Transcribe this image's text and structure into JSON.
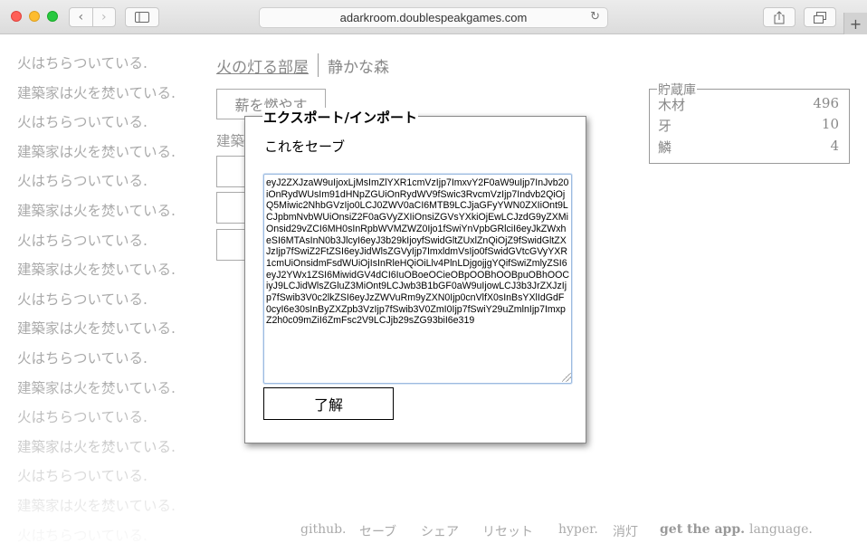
{
  "browser": {
    "url": "adarkroom.doublespeakgames.com",
    "back_glyph": "‹",
    "forward_glyph": "›",
    "reload_glyph": "↻",
    "new_tab_glyph": "+"
  },
  "notifications": [
    "火はちらついている.",
    "建築家は火を焚いている.",
    "火はちらついている.",
    "建築家は火を焚いている.",
    "火はちらついている.",
    "建築家は火を焚いている.",
    "火はちらついている.",
    "建築家は火を焚いている.",
    "火はちらついている.",
    "建築家は火を焚いている.",
    "火はちらついている.",
    "建築家は火を焚いている.",
    "火はちらついている.",
    "建築家は火を焚いている.",
    "火はちらついている.",
    "建築家は火を焚いている.",
    "火はちらついている."
  ],
  "header": {
    "tab_room": "火の灯る部屋",
    "tab_forest": "静かな森"
  },
  "room": {
    "stoke_fire_label": "薪を燃やす",
    "build_label": "建築"
  },
  "stores": {
    "legend": "貯蔵庫",
    "items": [
      {
        "name": "木材",
        "count": "496"
      },
      {
        "name": "牙",
        "count": "10"
      },
      {
        "name": "鱗",
        "count": "4"
      }
    ]
  },
  "dialog": {
    "title": "エクスポート/インポート",
    "description": "これをセーブ",
    "save_string": "eyJ2ZXJzaW9uIjoxLjMsImZlYXR1cmVzIjp7ImxvY2F0aW9uIjp7InJvb20iOnRydWUsIm91dHNpZGUiOnRydWV9fSwic3RvcmVzIjp7Indvb2QiOjQ5Miwic2NhbGVzIjo0LCJ0ZWV0aCI6MTB9LCJjaGFyYWN0ZXIiOnt9LCJpbmNvbWUiOnsiZ2F0aGVyZXIiOnsiZGVsYXkiOjEwLCJzdG9yZXMiOnsid29vZCI6MH0sInRpbWVMZWZ0Ijo1fSwiYnVpbGRlciI6eyJkZWxheSI6MTAsInN0b3JlcyI6eyJ3b29kIjoyfSwidGltZUxlZnQiOjZ9fSwidGltZXJzIjp7fSwiZ2FtZSI6eyJidWlsZGVyIjp7ImxldmVsIjo0fSwidGVtcGVyYXR1cmUiOnsidmFsdWUiOjIsInRleHQiOiLlv4PlnLDjgojjgYQifSwiZmlyZSI6eyJ2YWx1ZSI6MiwidGV4dCI6IuOBoeOCieOBpOOBhOOBpuOBhOOCiyJ9LCJidWlsZGluZ3MiOnt9LCJwb3B1bGF0aW9uIjowLCJ3b3JrZXJzIjp7fSwib3V0c2lkZSI6eyJzZWVuRm9yZXN0Ijp0cnVlfX0sInBsYXlIdGdF0cyI6e30sInByZXZpb3VzIjp7fSwib3V0ZmI0Ijp7fSwiY29uZmlnIjp7ImxpZ2h0c09mZiI6ZmFsc2V9LCJjb29sZG93biI6e319",
    "ok_label": "了解"
  },
  "footer": {
    "github": "github.",
    "save": "セーブ",
    "share": "シェア",
    "reset": "リセット",
    "hyper": "hyper.",
    "lights_off": "消灯",
    "get_app": "get the app.",
    "language": "language."
  }
}
